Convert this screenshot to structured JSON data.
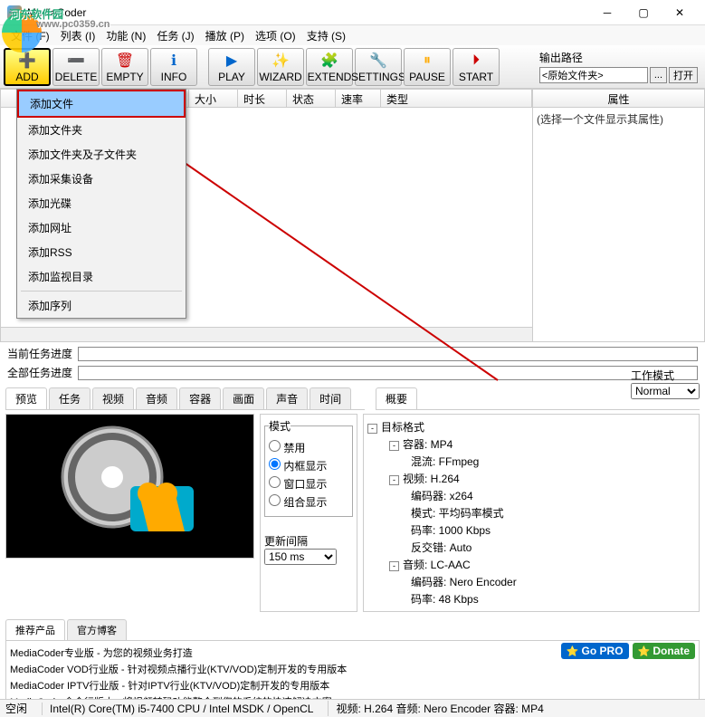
{
  "window": {
    "title": "MediaCoder"
  },
  "watermark": {
    "text": "河东软件园",
    "url": "www.pc0359.cn"
  },
  "menubar": {
    "items": [
      "文件 (F)",
      "列表 (I)",
      "功能 (N)",
      "任务 (J)",
      "播放 (P)",
      "选项 (O)",
      "支持 (S)"
    ]
  },
  "toolbar": {
    "add": "ADD",
    "delete": "DELETE",
    "empty": "EMPTY",
    "info": "INFO",
    "play": "PLAY",
    "wizard": "WIZARD",
    "extend": "EXTEND",
    "settings": "SETTINGS",
    "pause": "PAUSE",
    "start": "START",
    "output_label": "输出路径",
    "output_value": "<原始文件夹>",
    "browse": "...",
    "open": "打开"
  },
  "dropdown": {
    "items": [
      "添加文件",
      "添加文件夹",
      "添加文件夹及子文件夹",
      "添加采集设备",
      "添加光碟",
      "添加网址",
      "添加RSS",
      "添加监视目录",
      "添加序列"
    ]
  },
  "file_columns": {
    "c0": "",
    "c1": "大小",
    "c2": "时长",
    "c3": "状态",
    "c4": "速率",
    "c5": "类型"
  },
  "attr": {
    "header": "属性",
    "hint": "(选择一个文件显示其属性)"
  },
  "progress": {
    "current": "当前任务进度",
    "all": "全部任务进度",
    "work_mode": "工作模式",
    "work_value": "Normal"
  },
  "tabs": {
    "preview": "预览",
    "task": "任务",
    "video": "视频",
    "audio": "音频",
    "container": "容器",
    "picture": "画面",
    "sound": "声音",
    "time": "时间",
    "summary": "概要"
  },
  "mode": {
    "title": "模式",
    "disable": "禁用",
    "inline": "内框显示",
    "window": "窗口显示",
    "combo": "组合显示",
    "interval_label": "更新间隔",
    "interval_value": "150 ms"
  },
  "summary": {
    "root": "目标格式",
    "container": "容器: MP4",
    "mux": "混流: FFmpeg",
    "video": "视频: H.264",
    "encoder_v": "编码器: x264",
    "mode_v": "模式: 平均码率模式",
    "bitrate_v": "码率: 1000 Kbps",
    "interlace": "反交错: Auto",
    "audio": "音频: LC-AAC",
    "encoder_a": "编码器: Nero Encoder",
    "bitrate_a": "码率: 48 Kbps"
  },
  "recommend": {
    "tab1": "推荐产品",
    "tab2": "官方博客",
    "l1": "MediaCoder专业版 - 为您的视频业务打造",
    "l2": "MediaCoder VOD行业版 - 针对视频点播行业(KTV/VOD)定制开发的专用版本",
    "l3": "MediaCoder IPTV行业版 - 针对IPTV行业(KTV/VOD)定制开发的专用版本",
    "l4": "MediaCoder命令行版本 - 将视频转码功能整合到您的系统的快速解决方案",
    "gopro": "Go PRO",
    "donate": "Donate"
  },
  "status": {
    "idle": "空闲",
    "cpu": "Intel(R) Core(TM) i5-7400 CPU  / Intel MSDK / OpenCL",
    "vfmt": "视频: H.264  音频: Nero Encoder   容器: MP4"
  }
}
